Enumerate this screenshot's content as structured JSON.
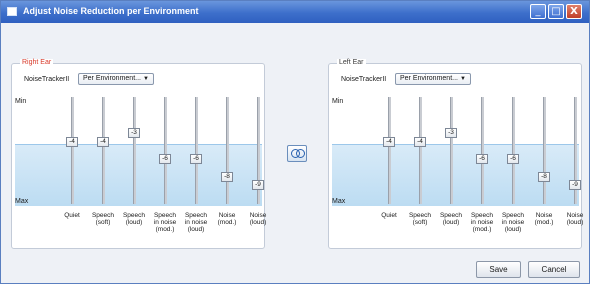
{
  "window": {
    "title": "Adjust Noise Reduction per Environment"
  },
  "titlebar_buttons": {
    "minimize": "_",
    "maximize": "□",
    "close": "X"
  },
  "panels": [
    {
      "legend": "Right Ear",
      "tracker_label": "NoiseTrackerII",
      "dropdown_value": "Per Environment...",
      "min_label": "Min",
      "max_label": "Max",
      "sliders": [
        {
          "label": "Quiet",
          "value": "-4",
          "level": 0.4
        },
        {
          "label": "Speech\n(soft)",
          "value": "-4",
          "level": 0.4
        },
        {
          "label": "Speech\n(loud)",
          "value": "-3",
          "level": 0.3
        },
        {
          "label": "Speech\nin noise\n(mod.)",
          "value": "-6",
          "level": 0.6
        },
        {
          "label": "Speech\nin noise\n(loud)",
          "value": "-6",
          "level": 0.6
        },
        {
          "label": "Noise\n(mod.)",
          "value": "-8",
          "level": 0.8
        },
        {
          "label": "Noise\n(loud)",
          "value": "-9",
          "level": 0.9
        }
      ]
    },
    {
      "legend": "Left Ear",
      "tracker_label": "NoiseTrackerII",
      "dropdown_value": "Per Environment...",
      "min_label": "Min",
      "max_label": "Max",
      "sliders": [
        {
          "label": "Quiet",
          "value": "-4",
          "level": 0.4
        },
        {
          "label": "Speech\n(soft)",
          "value": "-4",
          "level": 0.4
        },
        {
          "label": "Speech\n(loud)",
          "value": "-3",
          "level": 0.3
        },
        {
          "label": "Speech\nin noise\n(mod.)",
          "value": "-6",
          "level": 0.6
        },
        {
          "label": "Speech\nin noise\n(loud)",
          "value": "-6",
          "level": 0.6
        },
        {
          "label": "Noise\n(mod.)",
          "value": "-8",
          "level": 0.8
        },
        {
          "label": "Noise\n(loud)",
          "value": "-9",
          "level": 0.9
        }
      ]
    }
  ],
  "buttons": {
    "save": "Save",
    "cancel": "Cancel"
  },
  "colors": {
    "titlebar": "#3d6fcb",
    "right_ear_legend": "#d83a2a",
    "band": "#bcdcf2"
  },
  "icons": {
    "link": "link-ears-icon",
    "app": "window-app-icon"
  }
}
